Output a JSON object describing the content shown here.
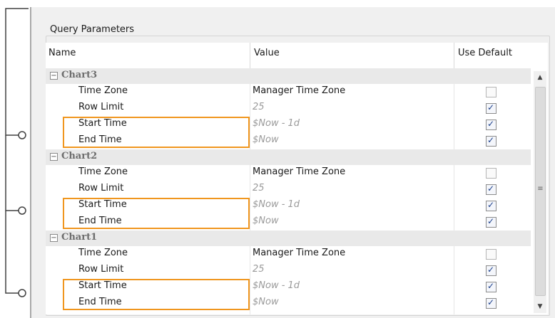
{
  "group_title": "Query Parameters",
  "columns": {
    "name": "Name",
    "value": "Value",
    "use_default": "Use Default"
  },
  "categories": [
    {
      "name": "Chart3",
      "rows": [
        {
          "name": "Time Zone",
          "value": "Manager Time Zone",
          "placeholder": false,
          "use_default": false
        },
        {
          "name": "Row Limit",
          "value": "25",
          "placeholder": true,
          "use_default": true
        },
        {
          "name": "Start Time",
          "value": "$Now - 1d",
          "placeholder": true,
          "use_default": true
        },
        {
          "name": "End Time",
          "value": "$Now",
          "placeholder": true,
          "use_default": true
        }
      ]
    },
    {
      "name": "Chart2",
      "rows": [
        {
          "name": "Time Zone",
          "value": "Manager Time Zone",
          "placeholder": false,
          "use_default": false
        },
        {
          "name": "Row Limit",
          "value": "25",
          "placeholder": true,
          "use_default": true
        },
        {
          "name": "Start Time",
          "value": "$Now - 1d",
          "placeholder": true,
          "use_default": true
        },
        {
          "name": "End Time",
          "value": "$Now",
          "placeholder": true,
          "use_default": true
        }
      ]
    },
    {
      "name": "Chart1",
      "rows": [
        {
          "name": "Time Zone",
          "value": "Manager Time Zone",
          "placeholder": false,
          "use_default": false
        },
        {
          "name": "Row Limit",
          "value": "25",
          "placeholder": true,
          "use_default": true
        },
        {
          "name": "Start Time",
          "value": "$Now - 1d",
          "placeholder": true,
          "use_default": true
        },
        {
          "name": "End Time",
          "value": "$Now",
          "placeholder": true,
          "use_default": true
        }
      ]
    }
  ],
  "icons": {
    "collapse": "collapse-minus-icon",
    "scroll_up": "scroll-up-arrow-icon",
    "scroll_down": "scroll-down-arrow-icon",
    "grip": "scroll-grip-icon"
  },
  "colors": {
    "highlight": "#f0961e",
    "category_bg": "#e9e9e9",
    "placeholder_text": "#9a9a9a"
  },
  "glyphs": {
    "minus": "−",
    "up": "▲",
    "down": "▼",
    "grip": "≡"
  }
}
